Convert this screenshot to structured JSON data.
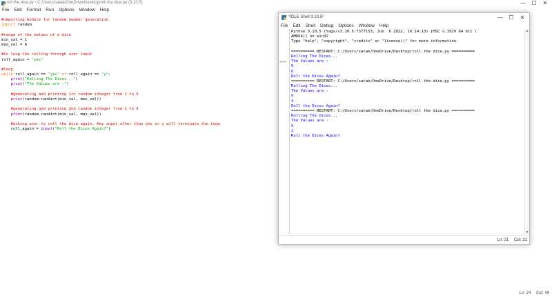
{
  "editor": {
    "title": "roll the dice.py - C:/Users/satak/OneDrive/Desktop/roll the dice.py (3.10.5)",
    "menu": [
      "File",
      "Edit",
      "Format",
      "Run",
      "Options",
      "Window",
      "Help"
    ],
    "code": [
      [
        {
          "t": "#importing module for random number generation",
          "c": "comment"
        }
      ],
      [
        {
          "t": "import",
          "c": "kw"
        },
        {
          "t": " random",
          "c": ""
        }
      ],
      [
        {
          "t": "",
          "c": ""
        }
      ],
      [
        {
          "t": "#range of the values of a dice",
          "c": "comment"
        }
      ],
      [
        {
          "t": "min_val = 1",
          "c": ""
        }
      ],
      [
        {
          "t": "max_val = 6",
          "c": ""
        }
      ],
      [
        {
          "t": "",
          "c": ""
        }
      ],
      [
        {
          "t": "#to loop the rolling through user input",
          "c": "comment"
        }
      ],
      [
        {
          "t": "roll_again = ",
          "c": ""
        },
        {
          "t": "\"yes\"",
          "c": "str"
        }
      ],
      [
        {
          "t": "",
          "c": ""
        }
      ],
      [
        {
          "t": "#loop",
          "c": "comment"
        }
      ],
      [
        {
          "t": "while",
          "c": "kw"
        },
        {
          "t": " roll_again == ",
          "c": ""
        },
        {
          "t": "\"yes\"",
          "c": "str"
        },
        {
          "t": " or",
          "c": "kw"
        },
        {
          "t": " roll_again == ",
          "c": ""
        },
        {
          "t": "\"y\"",
          "c": "str"
        },
        {
          "t": ":",
          "c": ""
        }
      ],
      [
        {
          "t": "    ",
          "c": ""
        },
        {
          "t": "print",
          "c": "fn"
        },
        {
          "t": "(",
          "c": ""
        },
        {
          "t": "\"Rolling The Dices...\"",
          "c": "str"
        },
        {
          "t": ")",
          "c": ""
        }
      ],
      [
        {
          "t": "    ",
          "c": ""
        },
        {
          "t": "print",
          "c": "fn"
        },
        {
          "t": "(",
          "c": ""
        },
        {
          "t": "\"The Values are :\"",
          "c": "str"
        },
        {
          "t": ")",
          "c": ""
        }
      ],
      [
        {
          "t": "",
          "c": ""
        }
      ],
      [
        {
          "t": "    #generating and printing 1st random integer from 1 to 6",
          "c": "comment"
        }
      ],
      [
        {
          "t": "    ",
          "c": ""
        },
        {
          "t": "print",
          "c": "fn"
        },
        {
          "t": "(random.randint(min_val, max_val))",
          "c": ""
        }
      ],
      [
        {
          "t": "",
          "c": ""
        }
      ],
      [
        {
          "t": "    #generating and printing 2nd random integer from 1 to 6",
          "c": "comment"
        }
      ],
      [
        {
          "t": "    ",
          "c": ""
        },
        {
          "t": "print",
          "c": "fn"
        },
        {
          "t": "(random.randint(min_val, max_val))",
          "c": ""
        }
      ],
      [
        {
          "t": "",
          "c": ""
        }
      ],
      [
        {
          "t": "    #asking user to roll the dice again. Any input other than yes or y will terminate the loop",
          "c": "comment"
        }
      ],
      [
        {
          "t": "    roll_again = ",
          "c": ""
        },
        {
          "t": "input",
          "c": "fn"
        },
        {
          "t": "(",
          "c": ""
        },
        {
          "t": "\"Roll the Dices Again?\"",
          "c": "str"
        },
        {
          "t": ")",
          "c": ""
        }
      ]
    ],
    "status": {
      "line": "Ln: 24",
      "col": "Col: 48"
    }
  },
  "shell": {
    "title": "*IDLE Shell 3.10.5*",
    "menu": [
      "File",
      "Edit",
      "Shell",
      "Debug",
      "Options",
      "Window",
      "Help"
    ],
    "prompt": ">>>",
    "lines": [
      {
        "t": "Python 3.10.5 (tags/v3.10.5:f377153, Jun  6 2022, 16:14:13) [MSC v.1929 64 bit (",
        "c": ""
      },
      {
        "t": "AMD64)] on win32",
        "c": ""
      },
      {
        "t": "Type \"help\", \"copyright\", \"credits\" or \"license()\" for more information.",
        "c": ""
      },
      {
        "t": "",
        "c": ""
      },
      {
        "t": "========== RESTART: C:/Users/satak/OneDrive/Desktop/roll the dice.py ==========",
        "c": ""
      },
      {
        "t": "Rolling The Dices...",
        "c": "blue"
      },
      {
        "t": "The Values are :",
        "c": "blue"
      },
      {
        "t": "6",
        "c": "blue"
      },
      {
        "t": "6",
        "c": "blue"
      },
      {
        "t": "Roll the Dices Again?",
        "c": "blue"
      },
      {
        "t": "========== RESTART: C:/Users/satak/OneDrive/Desktop/roll the dice.py ==========",
        "c": ""
      },
      {
        "t": "Rolling The Dices...",
        "c": "blue"
      },
      {
        "t": "The Values are :",
        "c": "blue"
      },
      {
        "t": "6",
        "c": "blue"
      },
      {
        "t": "4",
        "c": "blue"
      },
      {
        "t": "Roll the Dices Again?",
        "c": "blue"
      },
      {
        "t": "========== RESTART: C:/Users/satak/OneDrive/Desktop/roll the dice.py ==========",
        "c": ""
      },
      {
        "t": "Rolling The Dices...",
        "c": "blue"
      },
      {
        "t": "The Values are :",
        "c": "blue"
      },
      {
        "t": "5",
        "c": "blue"
      },
      {
        "t": "2",
        "c": "blue"
      },
      {
        "t": "Roll the Dices Again?",
        "c": "blue"
      }
    ],
    "status": {
      "line": "Ln: 21",
      "col": "Col: 21"
    }
  },
  "window_buttons": {
    "minimize": "—",
    "maximize": "☐",
    "close": "✕"
  },
  "colors": {
    "comment": "#dd0000",
    "keyword": "#ff7700",
    "string": "#00aa00",
    "builtin": "#900090",
    "output": "#0000ff"
  }
}
